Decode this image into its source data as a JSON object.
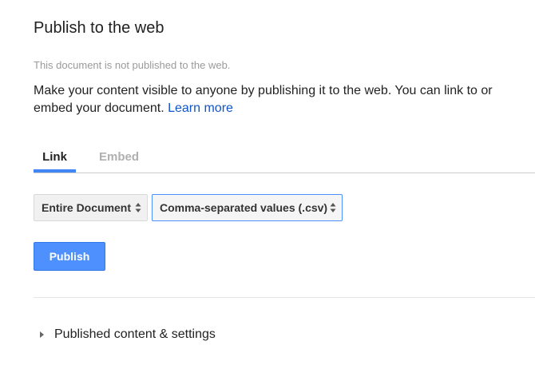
{
  "dialog": {
    "title": "Publish to the web",
    "status_text": "This document is not published to the web.",
    "description": "Make your content visible to anyone by publishing it to the web. You can link to or embed your document.",
    "learn_more": "Learn more"
  },
  "tabs": {
    "link": "Link",
    "embed": "Embed",
    "active": "Link"
  },
  "selects": {
    "scope": "Entire Document",
    "format": "Comma-separated values (.csv)"
  },
  "actions": {
    "publish": "Publish"
  },
  "section": {
    "label": "Published content & settings",
    "expanded": false
  },
  "colors": {
    "accent": "#4285f4",
    "publish_button": "#4d90fe",
    "link": "#1155cc",
    "muted_text": "#9a9a9a"
  },
  "icons": {
    "select_caret": "up-down-caret-icon",
    "section_toggle": "triangle-right-icon"
  }
}
